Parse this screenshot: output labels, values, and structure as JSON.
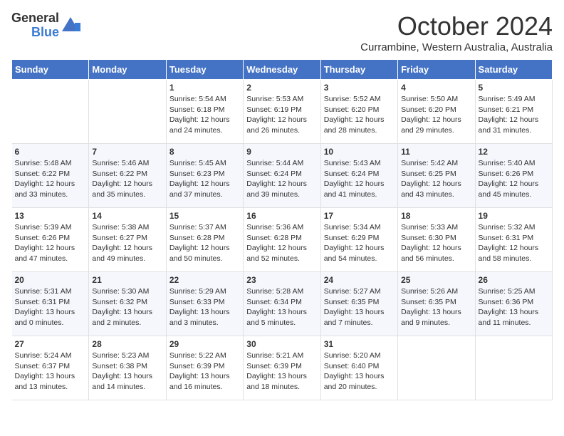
{
  "header": {
    "logo_general": "General",
    "logo_blue": "Blue",
    "title": "October 2024",
    "subtitle": "Currambine, Western Australia, Australia"
  },
  "days_of_week": [
    "Sunday",
    "Monday",
    "Tuesday",
    "Wednesday",
    "Thursday",
    "Friday",
    "Saturday"
  ],
  "weeks": [
    [
      {
        "day": "",
        "content": ""
      },
      {
        "day": "",
        "content": ""
      },
      {
        "day": "1",
        "content": "Sunrise: 5:54 AM\nSunset: 6:18 PM\nDaylight: 12 hours and 24 minutes."
      },
      {
        "day": "2",
        "content": "Sunrise: 5:53 AM\nSunset: 6:19 PM\nDaylight: 12 hours and 26 minutes."
      },
      {
        "day": "3",
        "content": "Sunrise: 5:52 AM\nSunset: 6:20 PM\nDaylight: 12 hours and 28 minutes."
      },
      {
        "day": "4",
        "content": "Sunrise: 5:50 AM\nSunset: 6:20 PM\nDaylight: 12 hours and 29 minutes."
      },
      {
        "day": "5",
        "content": "Sunrise: 5:49 AM\nSunset: 6:21 PM\nDaylight: 12 hours and 31 minutes."
      }
    ],
    [
      {
        "day": "6",
        "content": "Sunrise: 5:48 AM\nSunset: 6:22 PM\nDaylight: 12 hours and 33 minutes."
      },
      {
        "day": "7",
        "content": "Sunrise: 5:46 AM\nSunset: 6:22 PM\nDaylight: 12 hours and 35 minutes."
      },
      {
        "day": "8",
        "content": "Sunrise: 5:45 AM\nSunset: 6:23 PM\nDaylight: 12 hours and 37 minutes."
      },
      {
        "day": "9",
        "content": "Sunrise: 5:44 AM\nSunset: 6:24 PM\nDaylight: 12 hours and 39 minutes."
      },
      {
        "day": "10",
        "content": "Sunrise: 5:43 AM\nSunset: 6:24 PM\nDaylight: 12 hours and 41 minutes."
      },
      {
        "day": "11",
        "content": "Sunrise: 5:42 AM\nSunset: 6:25 PM\nDaylight: 12 hours and 43 minutes."
      },
      {
        "day": "12",
        "content": "Sunrise: 5:40 AM\nSunset: 6:26 PM\nDaylight: 12 hours and 45 minutes."
      }
    ],
    [
      {
        "day": "13",
        "content": "Sunrise: 5:39 AM\nSunset: 6:26 PM\nDaylight: 12 hours and 47 minutes."
      },
      {
        "day": "14",
        "content": "Sunrise: 5:38 AM\nSunset: 6:27 PM\nDaylight: 12 hours and 49 minutes."
      },
      {
        "day": "15",
        "content": "Sunrise: 5:37 AM\nSunset: 6:28 PM\nDaylight: 12 hours and 50 minutes."
      },
      {
        "day": "16",
        "content": "Sunrise: 5:36 AM\nSunset: 6:28 PM\nDaylight: 12 hours and 52 minutes."
      },
      {
        "day": "17",
        "content": "Sunrise: 5:34 AM\nSunset: 6:29 PM\nDaylight: 12 hours and 54 minutes."
      },
      {
        "day": "18",
        "content": "Sunrise: 5:33 AM\nSunset: 6:30 PM\nDaylight: 12 hours and 56 minutes."
      },
      {
        "day": "19",
        "content": "Sunrise: 5:32 AM\nSunset: 6:31 PM\nDaylight: 12 hours and 58 minutes."
      }
    ],
    [
      {
        "day": "20",
        "content": "Sunrise: 5:31 AM\nSunset: 6:31 PM\nDaylight: 13 hours and 0 minutes."
      },
      {
        "day": "21",
        "content": "Sunrise: 5:30 AM\nSunset: 6:32 PM\nDaylight: 13 hours and 2 minutes."
      },
      {
        "day": "22",
        "content": "Sunrise: 5:29 AM\nSunset: 6:33 PM\nDaylight: 13 hours and 3 minutes."
      },
      {
        "day": "23",
        "content": "Sunrise: 5:28 AM\nSunset: 6:34 PM\nDaylight: 13 hours and 5 minutes."
      },
      {
        "day": "24",
        "content": "Sunrise: 5:27 AM\nSunset: 6:35 PM\nDaylight: 13 hours and 7 minutes."
      },
      {
        "day": "25",
        "content": "Sunrise: 5:26 AM\nSunset: 6:35 PM\nDaylight: 13 hours and 9 minutes."
      },
      {
        "day": "26",
        "content": "Sunrise: 5:25 AM\nSunset: 6:36 PM\nDaylight: 13 hours and 11 minutes."
      }
    ],
    [
      {
        "day": "27",
        "content": "Sunrise: 5:24 AM\nSunset: 6:37 PM\nDaylight: 13 hours and 13 minutes."
      },
      {
        "day": "28",
        "content": "Sunrise: 5:23 AM\nSunset: 6:38 PM\nDaylight: 13 hours and 14 minutes."
      },
      {
        "day": "29",
        "content": "Sunrise: 5:22 AM\nSunset: 6:39 PM\nDaylight: 13 hours and 16 minutes."
      },
      {
        "day": "30",
        "content": "Sunrise: 5:21 AM\nSunset: 6:39 PM\nDaylight: 13 hours and 18 minutes."
      },
      {
        "day": "31",
        "content": "Sunrise: 5:20 AM\nSunset: 6:40 PM\nDaylight: 13 hours and 20 minutes."
      },
      {
        "day": "",
        "content": ""
      },
      {
        "day": "",
        "content": ""
      }
    ]
  ]
}
